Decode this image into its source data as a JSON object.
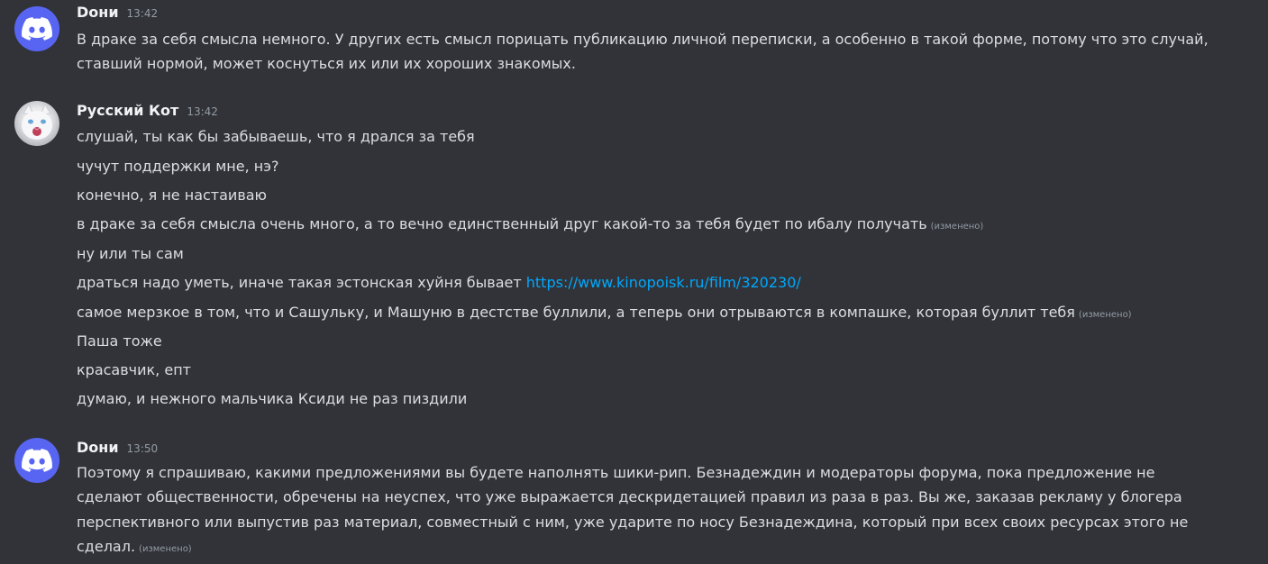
{
  "messages": [
    {
      "author": "Dони",
      "time": "13:42",
      "avatar_icon": "discord-logo-icon",
      "lines": [
        "В драке за себя смысла немного. У других есть смысл порицать публикацию личной переписки, а особенно в такой форме, потому что это случай,",
        "ставший нормой, может коснуться их или их хороших знакомых."
      ]
    },
    {
      "author": "Русский Кот",
      "time": "13:42",
      "avatar_icon": "white-cat-avatar-icon",
      "lines": [
        "слушай, ты как бы забываешь, что я дрался за тебя",
        "чучут поддержки мне, нэ?",
        "конечно, я не настаиваю",
        "в драке за себя смысла очень много, а то вечно единственный друг какой-то за тебя будет по ибалу получать",
        "ну или ты сам",
        "драться надо уметь, иначе такая эстонская хуйня бывает",
        "самое мерзкое в том, что и Сашульку, и Машуню в дестстве буллили, а теперь они отрываются в компашке, которая буллит тебя",
        "Паша тоже",
        "красавчик, епт",
        "думаю, и нежного мальчика Ксиди не раз пиздили"
      ],
      "link": "https://www.kinopoisk.ru/film/320230/"
    },
    {
      "author": "Dони",
      "time": "13:50",
      "avatar_icon": "discord-logo-icon",
      "lines": [
        "Поэтому я спрашиваю, какими предложениями вы будете наполнять шики-рип. Безнадеждин и модераторы форума, пока предложение не",
        "сделают общественности, обречены на неуспех, что уже выражается дескридетацией правил из раза в раз. Вы же, заказав рекламу у блогера",
        "перспективного или выпустив раз материал, совместный с ним, уже ударите по носу Безнадеждина, который при всех своих ресурсах этого не",
        "сделал."
      ]
    }
  ],
  "edited_label": "(изменено)",
  "colors": {
    "background": "#313338",
    "discord_blurple": "#5865f2",
    "link": "#00a8fc",
    "muted": "#949ba4",
    "text": "#dbdee1",
    "author": "#f2f3f5"
  }
}
